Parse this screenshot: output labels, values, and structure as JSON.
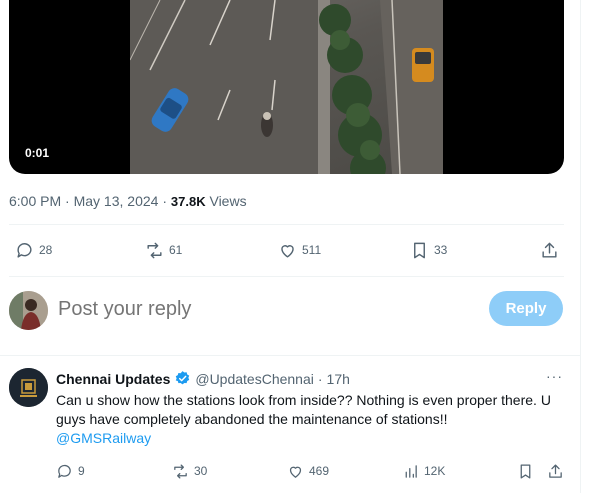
{
  "video": {
    "timestamp": "0:01"
  },
  "post_meta": {
    "time": "6:00 PM",
    "separator": "·",
    "date": "May 13, 2024",
    "views_count": "37.8K",
    "views_label": "Views"
  },
  "actions": {
    "replies": "28",
    "reposts": "61",
    "likes": "511",
    "bookmarks": "33"
  },
  "composer": {
    "placeholder": "Post your reply",
    "reply_button": "Reply"
  },
  "reply": {
    "author": "Chennai Updates",
    "handle": "@UpdatesChennai",
    "separator": "·",
    "time": "17h",
    "more": "···",
    "text": "Can u show how the stations look from inside?? Nothing is even proper there. U guys have completely abandoned the maintenance of stations!!",
    "mention": "@GMSRailway",
    "stats": {
      "replies": "9",
      "reposts": "30",
      "likes": "469",
      "views": "12K"
    }
  },
  "colors": {
    "accent": "#1d9bf0",
    "reply_button_disabled": "#8ecdf8",
    "muted_text": "#536471"
  },
  "icons": [
    "reply-icon",
    "repost-icon",
    "like-icon",
    "bookmark-icon",
    "share-icon",
    "views-icon",
    "verified-badge-icon",
    "more-icon"
  ]
}
